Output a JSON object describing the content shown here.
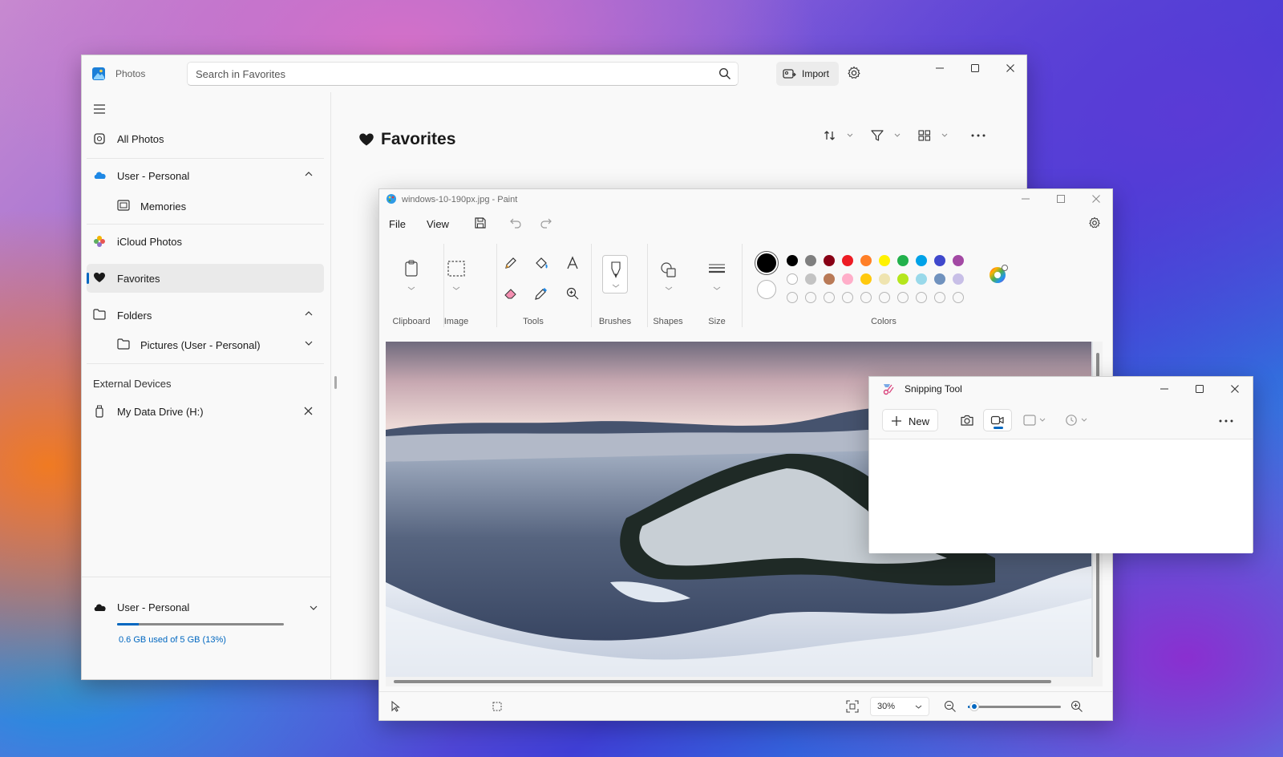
{
  "photos": {
    "app_title": "Photos",
    "search_placeholder": "Search in Favorites",
    "import_label": "Import",
    "nav": {
      "all_photos": "All Photos",
      "account_personal": "User - Personal",
      "memories": "Memories",
      "icloud": "iCloud Photos",
      "favorites": "Favorites",
      "folders": "Folders",
      "pictures_folder": "Pictures (User - Personal)",
      "external_devices_header": "External Devices",
      "data_drive": "My Data Drive (H:)"
    },
    "account": {
      "name": "User - Personal",
      "storage_text": "0.6 GB used of 5 GB (13%)",
      "storage_fraction": 0.13
    },
    "main_title": "Favorites"
  },
  "paint": {
    "title": "windows-10-190px.jpg - Paint",
    "menu": {
      "file": "File",
      "view": "View"
    },
    "groups": {
      "clipboard": "Clipboard",
      "image": "Image",
      "tools": "Tools",
      "brushes": "Brushes",
      "shapes": "Shapes",
      "size": "Size",
      "colors": "Colors"
    },
    "palette_row1": [
      "#000000",
      "#7f7f7f",
      "#880015",
      "#ed1c24",
      "#ff7f27",
      "#fff200",
      "#22b14c",
      "#00a2e8",
      "#3f48cc",
      "#a349a4"
    ],
    "palette_row2": [
      "#ffffff",
      "#c3c3c3",
      "#b97a57",
      "#ffaec9",
      "#ffc90e",
      "#efe4b0",
      "#b5e61d",
      "#99d9ea",
      "#7092be",
      "#c8bfe7"
    ],
    "primary_color": "#000000",
    "secondary_color": "#ffffff",
    "zoom": "30%"
  },
  "snipping": {
    "title": "Snipping Tool",
    "new_label": "New",
    "selected_mode": "video"
  }
}
